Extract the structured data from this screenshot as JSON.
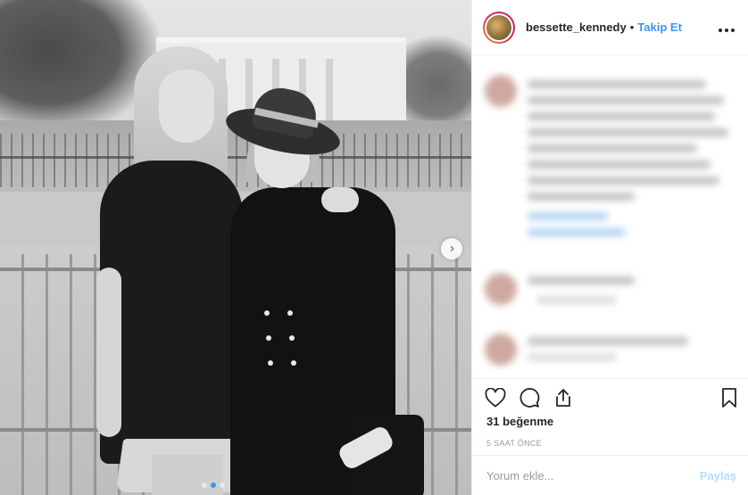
{
  "post": {
    "image_alt": "Black and white photo",
    "carousel": {
      "count": 3,
      "active_index": 1
    }
  },
  "header": {
    "username": "bessette_kennedy",
    "separator": "•",
    "follow_label": "Takip Et",
    "more_icon": "ellipsis-icon",
    "more_label": "•••"
  },
  "actions": {
    "like_icon": "heart-icon",
    "comment_icon": "comment-bubble-icon",
    "share_icon": "share-upload-icon",
    "save_icon": "bookmark-icon"
  },
  "likes_text": "31 beğenme",
  "timestamp": "5 SAAT ÖNCE",
  "comment_box": {
    "placeholder": "Yorum ekle...",
    "post_label": "Paylaş"
  },
  "navigation": {
    "next_icon": "chevron-right-icon",
    "next_glyph": "›"
  },
  "colors": {
    "accent": "#3897f0",
    "post_disabled": "#b2dffc",
    "text": "#262626",
    "muted": "#999999"
  }
}
